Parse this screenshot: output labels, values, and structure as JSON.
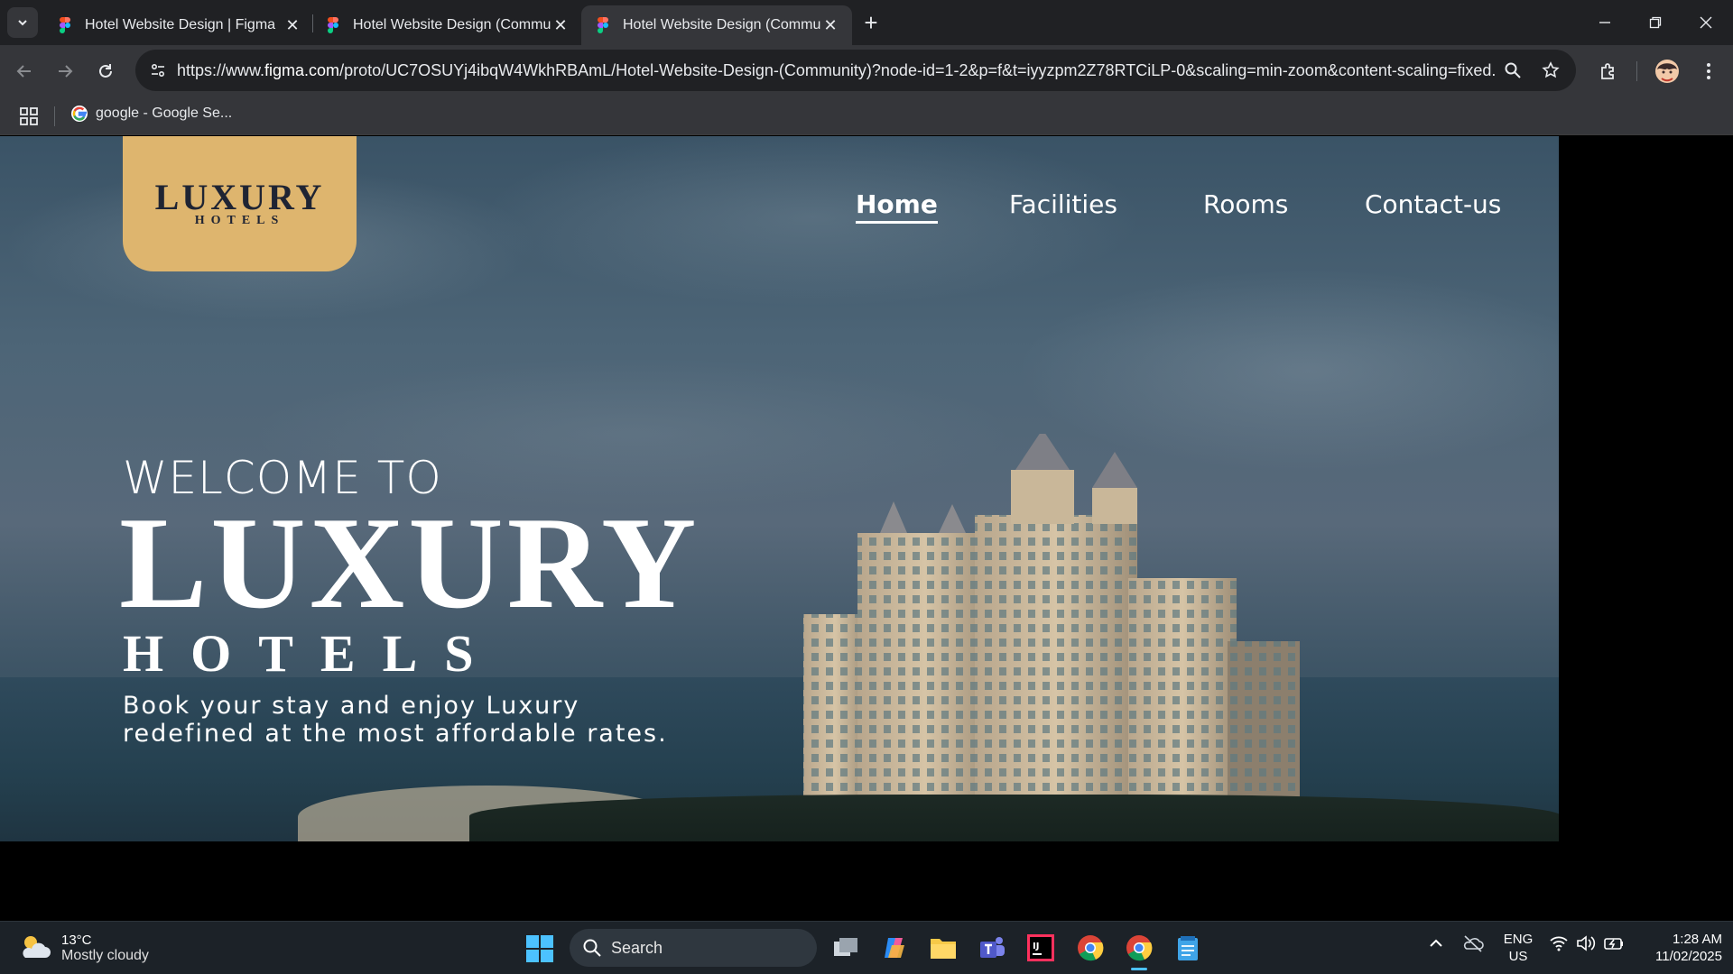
{
  "browser": {
    "tabs": [
      {
        "title": "Hotel Website Design | Figma",
        "active": false
      },
      {
        "title": "Hotel Website Design (Commu",
        "active": false
      },
      {
        "title": "Hotel Website Design (Commu",
        "active": true
      }
    ],
    "url_prefix": "https://www.",
    "url_domain": "figma.com",
    "url_rest": "/proto/UC7OSUYj4ibqW4WkhRBAmL/Hotel-Website-Design-(Community)?node-id=1-2&p=f&t=iyyzpm2Z78RTCiLP-0&scaling=min-zoom&content-scaling=fixed...",
    "bookmarks": [
      {
        "label": "google - Google Se..."
      }
    ]
  },
  "page": {
    "logo": {
      "line1": "LUXURY",
      "line2": "HOTELS"
    },
    "nav": [
      {
        "label": "Home",
        "active": true
      },
      {
        "label": "Facilities",
        "active": false
      },
      {
        "label": "Rooms",
        "active": false
      },
      {
        "label": "Contact-us",
        "active": false
      }
    ],
    "hero": {
      "welcome": "WELCOME TO",
      "title": "LUXURY",
      "subtitle": "HOTELS",
      "tagline_line1": "Book your stay and enjoy Luxury",
      "tagline_line2": "redefined at the most affordable rates."
    }
  },
  "taskbar": {
    "weather": {
      "temp": "13°C",
      "condition": "Mostly cloudy"
    },
    "search_placeholder": "Search",
    "language": {
      "line1": "ENG",
      "line2": "US"
    },
    "clock": {
      "time": "1:28 AM",
      "date": "11/02/2025"
    }
  },
  "colors": {
    "logo_bg": "#deb56e",
    "logo_text": "#1f2433",
    "chrome_dark": "#202124",
    "chrome_mid": "#35363a"
  }
}
